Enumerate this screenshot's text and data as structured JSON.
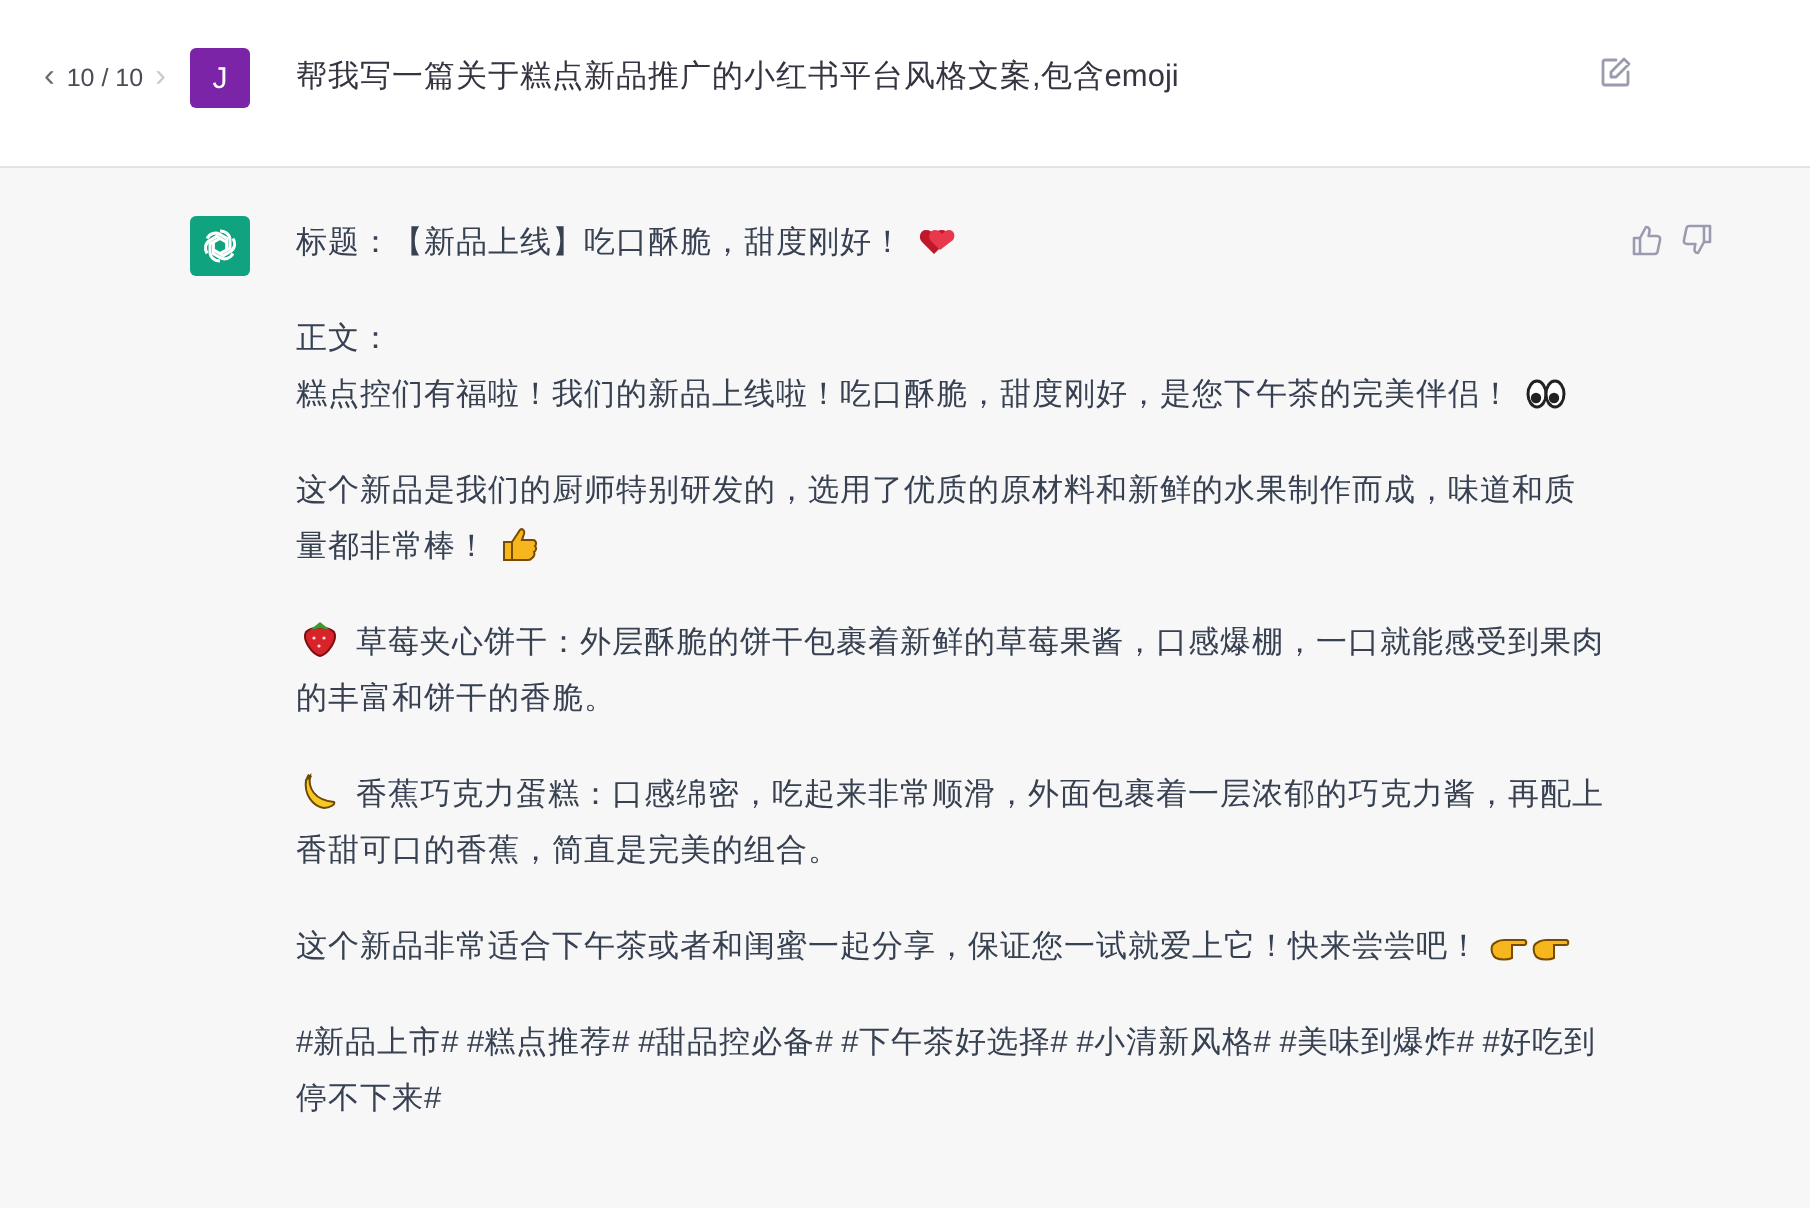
{
  "prompt": {
    "pager": {
      "prev": {
        "label": "‹",
        "disabled": false
      },
      "count": "10 / 10",
      "next": {
        "label": "›",
        "disabled": true
      }
    },
    "avatar": "J",
    "text": "帮我写一篇关于糕点新品推广的小红书平台风格文案,包含emoji"
  },
  "response": {
    "blocks": [
      {
        "lines": [
          {
            "text": "标题：【新品上线】吃口酥脆，甜度刚好！",
            "trail_emoji": {
              "kind": "heart"
            }
          }
        ]
      },
      {
        "lines": [
          {
            "text": "正文："
          },
          {
            "text": "糕点控们有福啦！我们的新品上线啦！吃口酥脆，甜度刚好，是您下午茶的完美伴侣！",
            "trail_emoji": {
              "kind": "eyes"
            }
          }
        ]
      },
      {
        "lines": [
          {
            "text": "这个新品是我们的厨师特别研发的，选用了优质的原材料和新鲜的水果制作而成，味道和质量都非常棒！",
            "trail_emoji": {
              "kind": "thumbs"
            }
          }
        ]
      },
      {
        "lines": [
          {
            "text": "草莓夹心饼干：外层酥脆的饼干包裹着新鲜的草莓果酱，口感爆棚，一口就能感受到果肉的丰富和饼干的香脆。",
            "lead_emoji": {
              "kind": "strawberry"
            }
          }
        ]
      },
      {
        "lines": [
          {
            "text": "香蕉巧克力蛋糕：口感绵密，吃起来非常顺滑，外面包裹着一层浓郁的巧克力酱，再配上香甜可口的香蕉，简直是完美的组合。",
            "lead_emoji": {
              "kind": "banana"
            }
          }
        ]
      },
      {
        "lines": [
          {
            "text": "这个新品非常适合下午茶或者和闺蜜一起分享，保证您一试就爱上它！快来尝尝吧！",
            "trail_emoji": {
              "kind": "pointing"
            }
          }
        ]
      },
      {
        "lines": [
          {
            "text": "#新品上市# #糕点推荐# #甜品控必备# #下午茶好选择# #小清新风格# #美味到爆炸# #好吃到停不下来#"
          }
        ]
      }
    ]
  }
}
